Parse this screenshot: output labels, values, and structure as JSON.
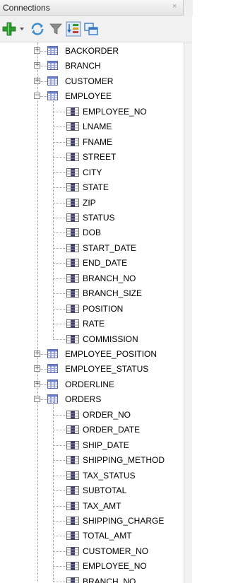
{
  "panel": {
    "title": "Connections",
    "close_glyph": "×"
  },
  "toolbar": {
    "buttons": [
      {
        "name": "add-connection-icon"
      },
      {
        "name": "dropdown-arrow-icon"
      },
      {
        "name": "refresh-icon"
      },
      {
        "name": "filter-icon"
      },
      {
        "name": "schema-browser-icon"
      },
      {
        "name": "connections-panel-icon"
      }
    ]
  },
  "tree": {
    "top_rows": [
      {
        "label": "BACKORDER",
        "state": "collapsed"
      },
      {
        "label": "BRANCH",
        "state": "collapsed"
      },
      {
        "label": "CUSTOMER",
        "state": "collapsed"
      },
      {
        "label": "EMPLOYEE",
        "state": "expanded"
      }
    ],
    "employee_columns": [
      "EMPLOYEE_NO",
      "LNAME",
      "FNAME",
      "STREET",
      "CITY",
      "STATE",
      "ZIP",
      "STATUS",
      "DOB",
      "START_DATE",
      "END_DATE",
      "BRANCH_NO",
      "BRANCH_SIZE",
      "POSITION",
      "RATE",
      "COMMISSION"
    ],
    "middle_rows": [
      {
        "label": "EMPLOYEE_POSITION",
        "state": "collapsed"
      },
      {
        "label": "EMPLOYEE_STATUS",
        "state": "collapsed"
      },
      {
        "label": "ORDERLINE",
        "state": "collapsed"
      },
      {
        "label": "ORDERS",
        "state": "expanded"
      }
    ],
    "orders_columns": [
      "ORDER_NO",
      "ORDER_DATE",
      "SHIP_DATE",
      "SHIPPING_METHOD",
      "TAX_STATUS",
      "SUBTOTAL",
      "TAX_AMT",
      "SHIPPING_CHARGE",
      "TOTAL_AMT",
      "CUSTOMER_NO",
      "EMPLOYEE_NO",
      "BRANCH_NO"
    ],
    "expand_glyph": "+",
    "collapse_glyph": "−"
  }
}
